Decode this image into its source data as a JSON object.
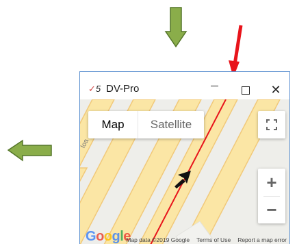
{
  "window": {
    "title": "DV-Pro",
    "logo_text": "5",
    "buttons": {
      "minimize": "—",
      "maximize": "□",
      "close": "✕"
    }
  },
  "map": {
    "type_tabs": [
      {
        "label": "Map",
        "active": true
      },
      {
        "label": "Satellite",
        "active": false
      }
    ],
    "road_label": "Ioa",
    "zoom_in": "+",
    "zoom_out": "−",
    "attribution": {
      "data": "Map data ©2019 Google",
      "terms": "Terms of Use",
      "report": "Report a map error"
    },
    "google_logo": "Google",
    "colors": {
      "road_fill": "#fbe6a5",
      "road_edge": "#f1c97a",
      "route": "#e8141b",
      "background": "#eeeeea"
    }
  },
  "annotations": {
    "down_arrow_color": "#7a9a3c",
    "left_arrow_color": "#7a9a3c",
    "red_arrow_color": "#e8141b"
  }
}
